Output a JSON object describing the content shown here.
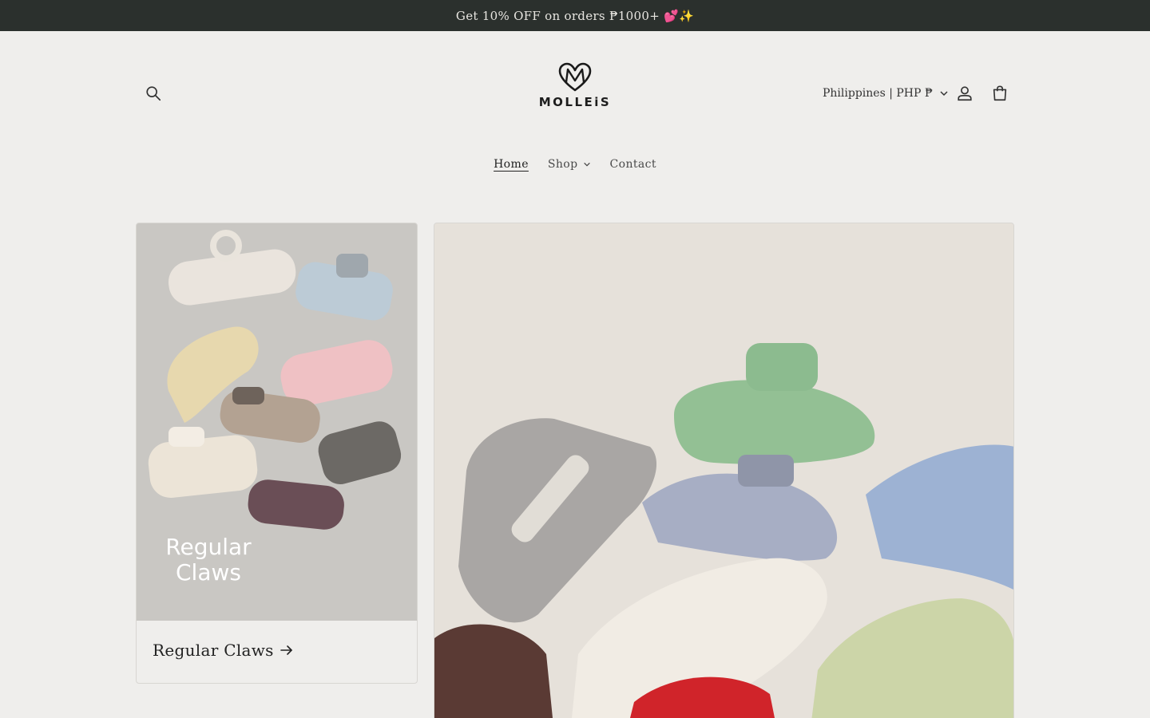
{
  "announcement": {
    "text": "Get 10% OFF on orders ₱1000+ 💕✨"
  },
  "header": {
    "logo_text": "MOLLEiS",
    "locale_label": "Philippines | PHP ₱",
    "icons": {
      "search": "search-icon",
      "account": "account-icon",
      "cart": "cart-icon",
      "chevron": "chevron-down-icon"
    }
  },
  "nav": {
    "items": [
      {
        "label": "Home",
        "active": true
      },
      {
        "label": "Shop",
        "has_dropdown": true
      },
      {
        "label": "Contact"
      }
    ]
  },
  "collections": {
    "regular": {
      "image_text_line1": "Regular",
      "image_text_line2": "Claws",
      "caption": "Regular Claws"
    }
  },
  "colors": {
    "background": "#efeeec",
    "announcement_bg": "#2b302d",
    "text": "#2c2c2c"
  }
}
